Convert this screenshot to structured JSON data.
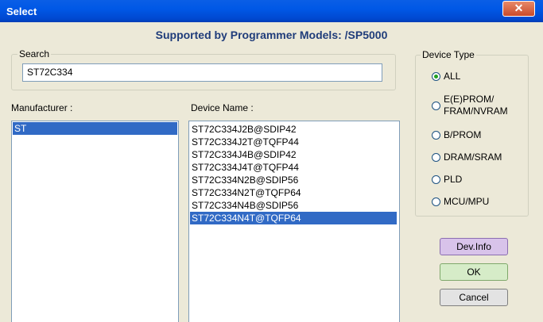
{
  "window": {
    "title": "Select",
    "close_glyph": "✕"
  },
  "header": "Supported by Programmer Models: /SP5000",
  "search": {
    "legend": "Search",
    "value": "ST72C334"
  },
  "manufacturer": {
    "label": "Manufacturer :",
    "items": [
      "ST"
    ],
    "selected": "ST"
  },
  "device": {
    "label": "Device Name :",
    "items": [
      "ST72C334J2B@SDIP42",
      "ST72C334J2T@TQFP44",
      "ST72C334J4B@SDIP42",
      "ST72C334J4T@TQFP44",
      "ST72C334N2B@SDIP56",
      "ST72C334N2T@TQFP64",
      "ST72C334N4B@SDIP56",
      "ST72C334N4T@TQFP64"
    ],
    "selected_index": 7
  },
  "device_type": {
    "legend": "Device Type",
    "options": [
      "ALL",
      "E(E)PROM/\nFRAM/NVRAM",
      "B/PROM",
      "DRAM/SRAM",
      "PLD",
      "MCU/MPU"
    ],
    "selected": "ALL"
  },
  "buttons": {
    "dev_info": "Dev.Info",
    "ok": "OK",
    "cancel": "Cancel"
  }
}
